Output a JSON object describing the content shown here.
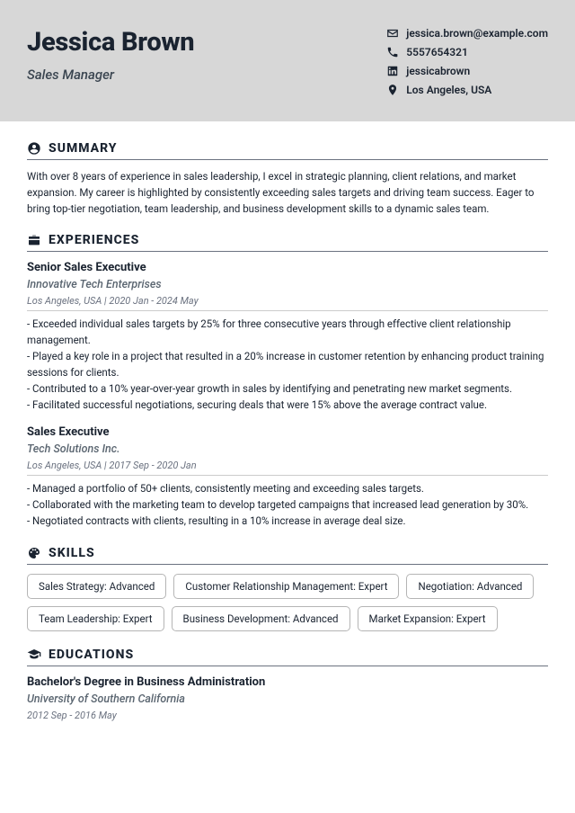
{
  "header": {
    "name": "Jessica Brown",
    "job_title": "Sales Manager",
    "contacts": {
      "email": "jessica.brown@example.com",
      "phone": "5557654321",
      "linkedin": "jessicabrown",
      "location": "Los Angeles, USA"
    }
  },
  "sections": {
    "summary": {
      "title": "SUMMARY",
      "text": "With over 8 years of experience in sales leadership, I excel in strategic planning, client relations, and market expansion. My career is highlighted by consistently exceeding sales targets and driving team success. Eager to bring top-tier negotiation, team leadership, and business development skills to a dynamic sales team."
    },
    "experiences": {
      "title": "EXPERIENCES",
      "items": [
        {
          "title": "Senior Sales Executive",
          "company": "Innovative Tech Enterprises",
          "meta": "Los Angeles, USA  |  2020 Jan - 2024 May",
          "bullets": [
            "- Exceeded individual sales targets by 25% for three consecutive years through effective client relationship management.",
            "- Played a key role in a project that resulted in a 20% increase in customer retention by enhancing product training sessions for clients.",
            "- Contributed to a 10% year-over-year growth in sales by identifying and penetrating new market segments.",
            "- Facilitated successful negotiations, securing deals that were 15% above the average contract value."
          ]
        },
        {
          "title": "Sales Executive",
          "company": "Tech Solutions Inc.",
          "meta": "Los Angeles, USA  |  2017 Sep - 2020 Jan",
          "bullets": [
            "- Managed a portfolio of 50+ clients, consistently meeting and exceeding sales targets.",
            "- Collaborated with the marketing team to develop targeted campaigns that increased lead generation by 30%.",
            "- Negotiated contracts with clients, resulting in a 10% increase in average deal size."
          ]
        }
      ]
    },
    "skills": {
      "title": "SKILLS",
      "items": [
        "Sales Strategy: Advanced",
        "Customer Relationship Management: Expert",
        "Negotiation: Advanced",
        "Team Leadership: Expert",
        "Business Development: Advanced",
        "Market Expansion: Expert"
      ]
    },
    "educations": {
      "title": "EDUCATIONS",
      "items": [
        {
          "degree": "Bachelor's Degree in Business Administration",
          "school": "University of Southern California",
          "meta": "2012 Sep - 2016 May"
        }
      ]
    }
  }
}
